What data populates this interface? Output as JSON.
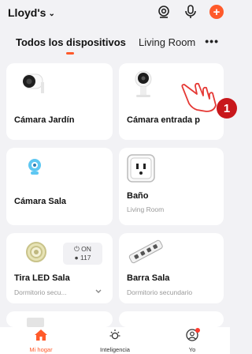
{
  "header": {
    "home_name": "Lloyd's",
    "chevron": "⌄"
  },
  "tabs": [
    {
      "label": "Todos los dispositivos",
      "active": true
    },
    {
      "label": "Living Room",
      "active": false
    }
  ],
  "more_label": "•••",
  "devices": [
    {
      "name": "Cámara Jardín",
      "icon": "outdoor-camera-icon"
    },
    {
      "name": "Cámara entrada p",
      "icon": "indoor-camera-icon"
    },
    {
      "name": "Cámara Sala",
      "icon": "blue-camera-icon"
    },
    {
      "name": "Baño",
      "sub": "Living Room",
      "icon": "smart-plug-icon"
    },
    {
      "name": "Tira LED Sala",
      "sub": "Dormitorio secu...",
      "icon": "led-strip-icon",
      "status": {
        "on": "ON",
        "value": "117"
      }
    },
    {
      "name": "Barra Sala",
      "sub": "Dormitorio secundario",
      "icon": "power-strip-icon"
    }
  ],
  "bottom_nav": [
    {
      "label": "Mi hogar",
      "active": true,
      "icon": "home-icon"
    },
    {
      "label": "Inteligencia",
      "active": false,
      "icon": "smart-sun-icon"
    },
    {
      "label": "Yo",
      "active": false,
      "icon": "profile-icon"
    }
  ],
  "overlay": {
    "step_number": "1"
  },
  "colors": {
    "accent": "#ff5a2a",
    "badge": "#c8171b",
    "background": "#f2f2f5"
  }
}
